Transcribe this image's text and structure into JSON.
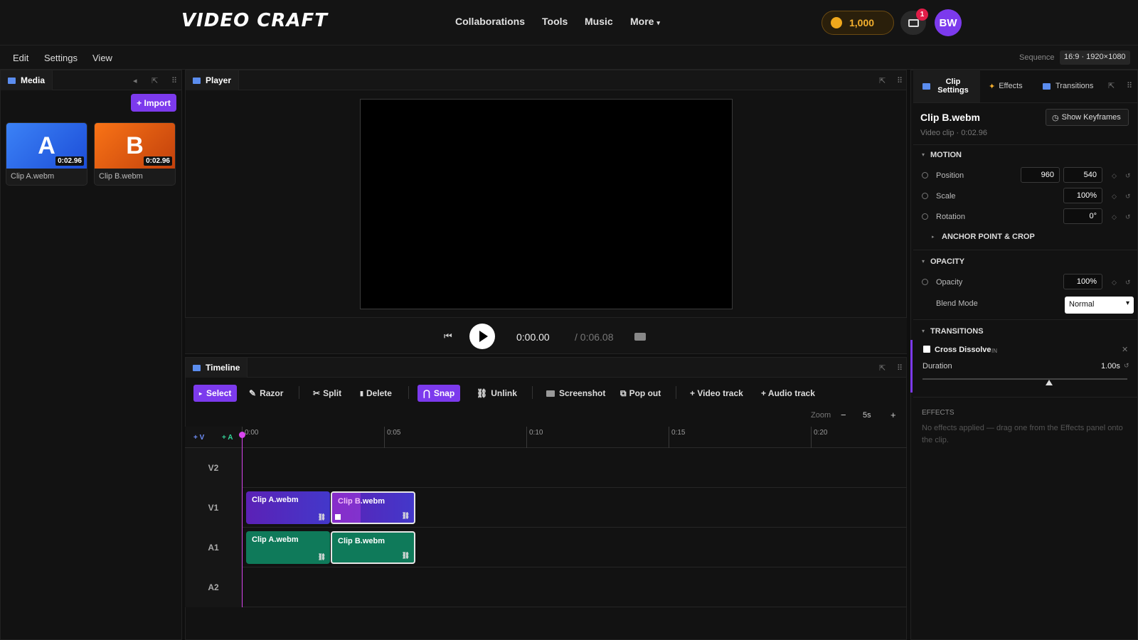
{
  "app": {
    "logo": "VIDEO CRAFT"
  },
  "nav": [
    "Collaborations",
    "Tools",
    "Music",
    "More"
  ],
  "user": {
    "coins": "1,000",
    "notifications": "1",
    "initials": "BW"
  },
  "menu": [
    "Edit",
    "Settings",
    "View"
  ],
  "sequence": {
    "label": "Sequence",
    "value": "16:9 · 1920×1080"
  },
  "media": {
    "tab": "Media",
    "import_label": "+ Import",
    "items": [
      {
        "letter": "A",
        "duration": "0:02.96",
        "name": "Clip A.webm"
      },
      {
        "letter": "B",
        "duration": "0:02.96",
        "name": "Clip B.webm"
      }
    ]
  },
  "player": {
    "tab": "Player",
    "time": "0:00.00",
    "total": "/ 0:06.08"
  },
  "timeline": {
    "tab": "Timeline",
    "tools": [
      "Select",
      "Razor",
      "Split",
      "Delete",
      "Snap",
      "Unlink",
      "Screenshot",
      "Pop out",
      "+ Video track",
      "+ Audio track"
    ],
    "zoom_label": "Zoom",
    "zoom_value": "5s",
    "zoom_minus": "−",
    "zoom_plus": "+",
    "add_v": "+ V",
    "add_a": "+ A",
    "ticks": [
      "0:00",
      "0:05",
      "0:10",
      "0:15",
      "0:20"
    ],
    "tracks": [
      "V2",
      "V1",
      "A1",
      "A2"
    ],
    "clips": {
      "v1a": "Clip A.webm",
      "v1b": "Clip B.webm",
      "a1a": "Clip A.webm",
      "a1b": "Clip B.webm"
    }
  },
  "inspector": {
    "tabs": [
      "Clip Settings",
      "Effects",
      "Transitions"
    ],
    "clip_name": "Clip B.webm",
    "clip_meta": "Video clip · 0:02.96",
    "show_keyframes": "Show Keyframes",
    "motion": {
      "title": "MOTION",
      "position_label": "Position",
      "position_x": "960",
      "position_y": "540",
      "scale_label": "Scale",
      "scale": "100%",
      "rotation_label": "Rotation",
      "rotation": "0°",
      "anchor_label": "ANCHOR POINT & CROP"
    },
    "opacity": {
      "title": "OPACITY",
      "label": "Opacity",
      "value": "100%",
      "blend_label": "Blend Mode",
      "blend_value": "Normal"
    },
    "transitions": {
      "title": "TRANSITIONS",
      "name": "Cross Dissolve",
      "tag": "IN",
      "duration_label": "Duration",
      "duration": "1.00s"
    },
    "effects": {
      "title": "EFFECTS",
      "empty": "No effects applied — drag one from the Effects panel onto the clip."
    }
  }
}
